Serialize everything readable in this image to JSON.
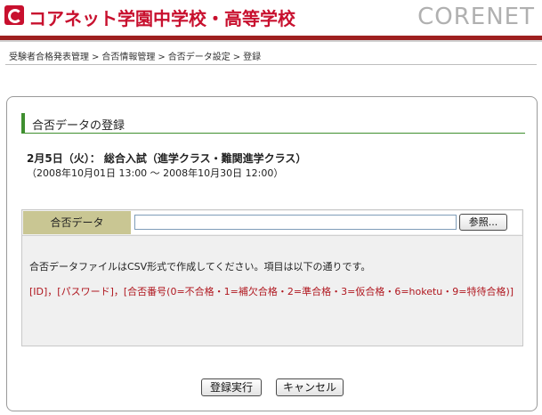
{
  "header": {
    "school_name": "コアネット学園中学校・高等学校",
    "brand": "CORENET",
    "logo_icon": "school-logo-icon",
    "accent_color": "#c8102e"
  },
  "breadcrumb": {
    "items": [
      "受験者合格発表管理",
      "合否情報管理",
      "合否データ設定",
      "登録"
    ],
    "separator": ">"
  },
  "section": {
    "title": "合否データの登録",
    "exam_name": "2月5日（火）： 総合入試（進学クラス・難関進学クラス）",
    "exam_period": "（2008年10月01日 13:00 ～ 2008年10月30日 12:00）"
  },
  "form": {
    "field_label": "合否データ",
    "file_value": "",
    "browse_label": "参照...",
    "info": "合否データファイルはCSV形式で作成してください。項目は以下の通りです。",
    "format": "[ID]，[パスワード]，[合否番号(0=不合格・1=補欠合格・2=準合格・3=仮合格・6=hoketu・9=特待合格)]"
  },
  "actions": {
    "submit_label": "登録実行",
    "cancel_label": "キャンセル"
  }
}
